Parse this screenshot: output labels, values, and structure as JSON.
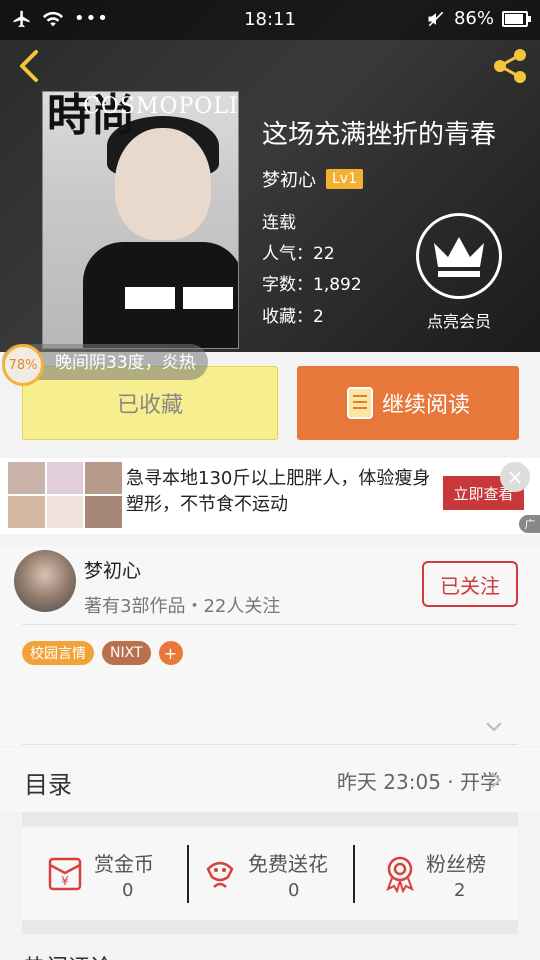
{
  "status_bar": {
    "time": "18:11",
    "battery": "86%",
    "icons": [
      "airplane-icon",
      "wifi-icon",
      "more-dots-icon",
      "mute-icon",
      "battery-icon"
    ]
  },
  "book": {
    "title": "这场充满挫折的青春",
    "author": "梦初心",
    "level": "Lv1",
    "status": "连载",
    "popularity": "人气：22",
    "word_count": "字数：1,892",
    "collections": "收藏：2",
    "cover_magazine_cn": "時尚",
    "cover_magazine_en": "COSMOPOLITAN"
  },
  "vip": {
    "label": "点亮会员"
  },
  "weather": {
    "percent": "78%",
    "text": "晚间阴33度，炎热"
  },
  "actions": {
    "favorited": "已收藏",
    "continue_reading": "继续阅读"
  },
  "ad": {
    "text": "急寻本地130斤以上肥胖人，体验瘦身塑形，不节食不运动",
    "button": "立即查看",
    "close": "×",
    "mark": "广"
  },
  "author_card": {
    "name": "梦初心",
    "info": "著有3部作品・22人关注",
    "follow": "已关注"
  },
  "tags": [
    {
      "label": "校园言情",
      "color": "#f2a23a"
    },
    {
      "label": "NIXT",
      "color": "#b8704e"
    },
    {
      "label": "+",
      "color": "#e8773a"
    }
  ],
  "toc": {
    "label": "目录",
    "latest": "昨天 23:05 · 开学"
  },
  "stats": [
    {
      "label": "赏金币",
      "value": "0",
      "icon": "red-envelope-icon"
    },
    {
      "label": "免费送花",
      "value": "0",
      "icon": "flower-icon"
    },
    {
      "label": "粉丝榜",
      "value": "2",
      "icon": "award-icon"
    }
  ],
  "bottom_partial": "热门评论"
}
